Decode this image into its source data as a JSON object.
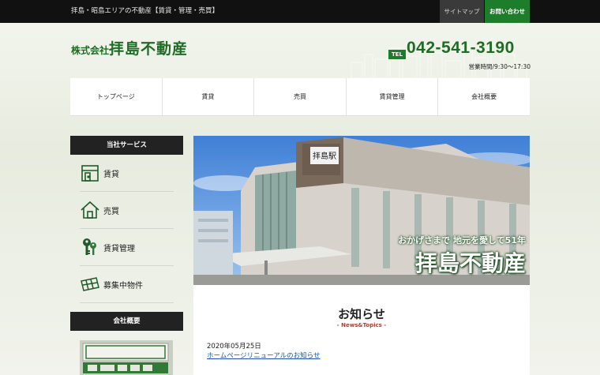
{
  "topbar": {
    "tagline": "拝島・昭島エリアの不動産【賃貸・管理・売買】",
    "sitemap": "サイトマップ",
    "contact": "お問い合わせ"
  },
  "header": {
    "logo_small": "株式会社",
    "logo_big": "拝島不動産",
    "tel_label": "TEL",
    "tel_number": "042-541-3190",
    "hours": "営業時間/9:30～17:30"
  },
  "nav": {
    "items": [
      "トップページ",
      "賃貸",
      "売買",
      "賃貸管理",
      "会社概要"
    ]
  },
  "sidebar": {
    "services_heading": "当社サービス",
    "services": [
      {
        "label": "賃貸",
        "icon": "door-icon"
      },
      {
        "label": "売買",
        "icon": "house-icon"
      },
      {
        "label": "賃貸管理",
        "icon": "keys-icon"
      },
      {
        "label": "募集中物件",
        "icon": "map-icon"
      }
    ],
    "company_heading": "会社概要"
  },
  "hero": {
    "station_sign": "拝島駅",
    "tagline": "おかげさまで 地元を愛して51年",
    "name": "拝島不動産"
  },
  "news": {
    "title": "お知らせ",
    "subtitle": "- News&Topics -",
    "date": "2020年05月25日",
    "link": "ホームページリニューアルのお知らせ"
  },
  "colors": {
    "brand_green": "#1e7d2b",
    "topbar_bg": "#111111",
    "news_sub": "#c0392b",
    "link": "#1b57b0"
  }
}
